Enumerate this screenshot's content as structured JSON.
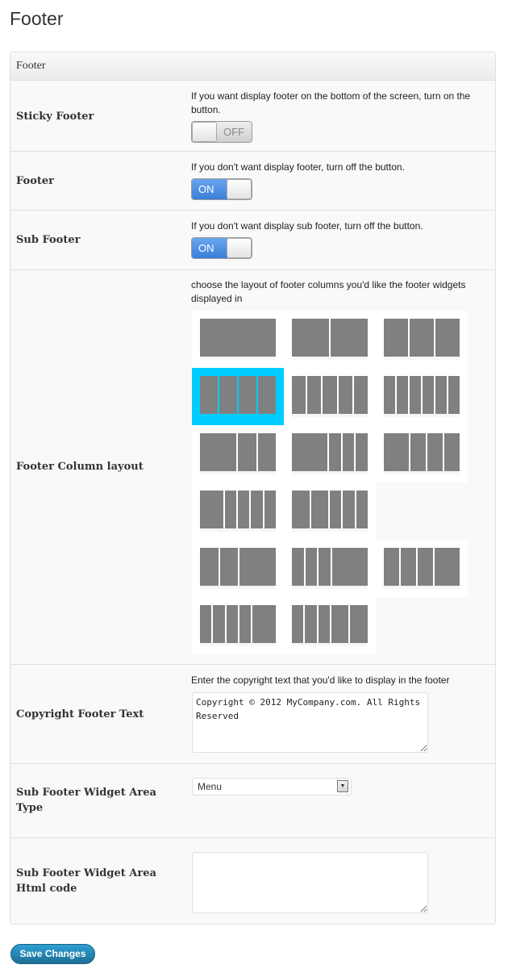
{
  "page_title": "Footer",
  "panel_title": "Footer",
  "rows": {
    "sticky": {
      "label": "Sticky Footer",
      "description": "If you want display footer on the bottom of the screen, turn on the button.",
      "state": "OFF"
    },
    "footer": {
      "label": "Footer",
      "description": "If you don't want display footer, turn off the button.",
      "state": "ON"
    },
    "sub_footer": {
      "label": "Sub Footer",
      "description": "If you don't want display sub footer, turn off the button.",
      "state": "ON"
    },
    "column_layout": {
      "label": "Footer Column layout",
      "description": "choose the layout of footer columns you'd like the footer widgets displayed in",
      "selected_index": 3,
      "selected_color": "#00ccff",
      "layouts": [
        [
          1
        ],
        [
          1,
          1
        ],
        [
          1,
          1,
          1
        ],
        [
          1,
          1,
          1,
          1
        ],
        [
          1,
          1,
          1,
          1,
          1
        ],
        [
          1,
          1,
          1,
          1,
          1,
          1
        ],
        [
          2,
          1,
          1
        ],
        [
          3,
          1,
          1,
          1
        ],
        [
          31,
          19,
          19,
          19
        ],
        [
          2,
          1,
          1,
          1,
          1
        ],
        [
          3,
          3,
          2,
          2,
          2
        ],
        [
          1,
          1,
          2
        ],
        [
          1,
          1,
          1,
          3
        ],
        [
          19,
          19,
          19,
          31
        ],
        [
          1,
          1,
          1,
          1,
          2
        ],
        [
          2,
          2,
          2,
          3,
          3
        ]
      ]
    },
    "copyright": {
      "label": "Copyright Footer Text",
      "description": "Enter the copyright text that you'd like to display in the footer",
      "value": "Copyright © 2012 MyCompany.com. All Rights Reserved"
    },
    "widget_type": {
      "label": "Sub Footer Widget Area Type",
      "value": "Menu"
    },
    "widget_html": {
      "label": "Sub Footer Widget Area Html code",
      "value": ""
    }
  },
  "save_label": "Save Changes",
  "accent_color": "#2e9fd2"
}
